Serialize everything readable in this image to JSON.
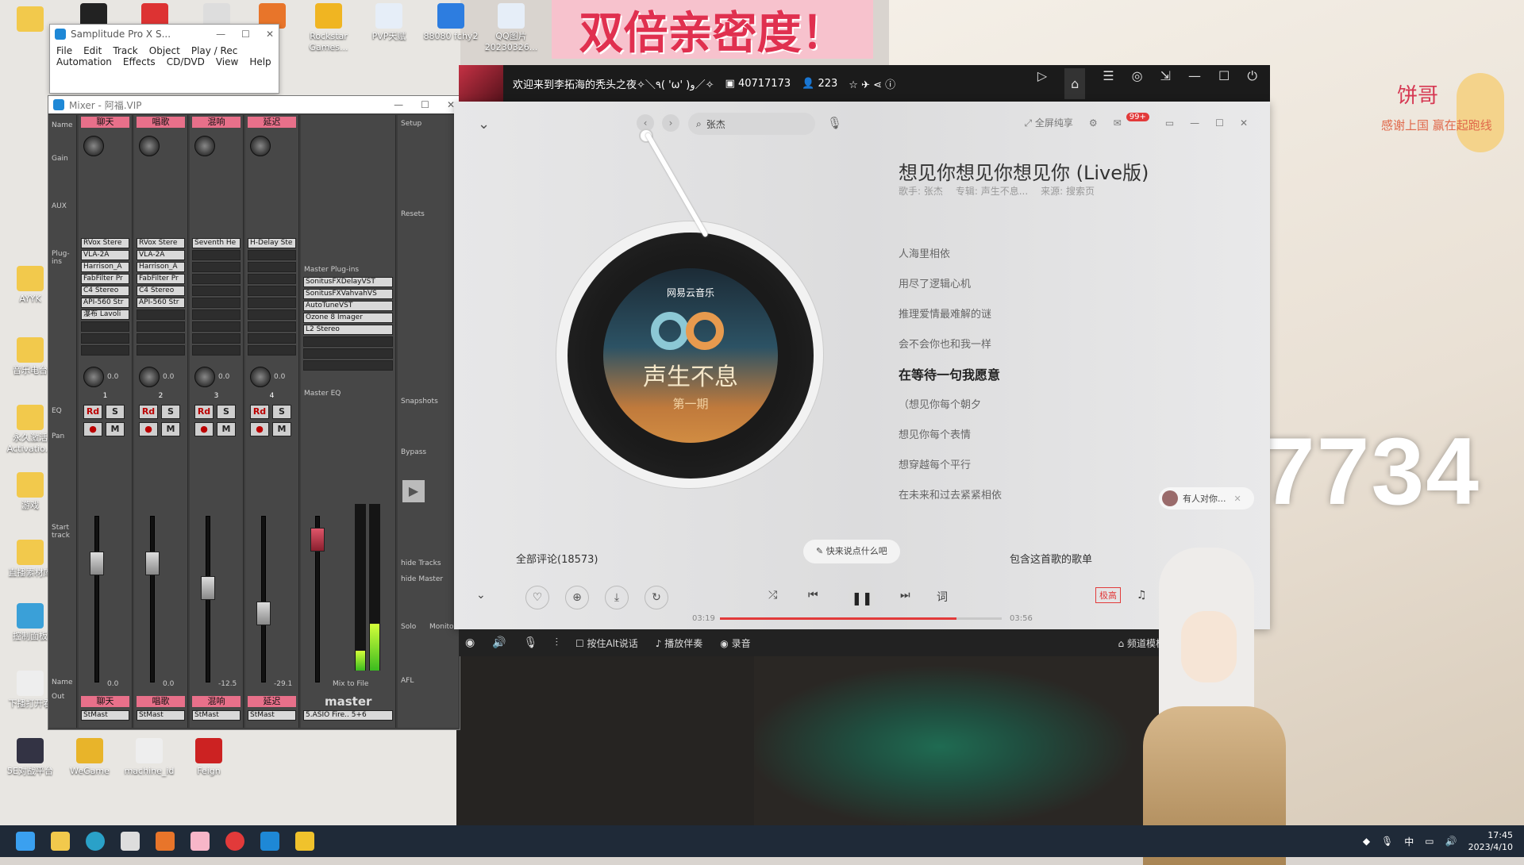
{
  "banner": {
    "text": "双倍亲密度！"
  },
  "big_number": "7734",
  "sticker": {
    "name": "饼哥",
    "thanks": "感谢上国 赢在起跑线"
  },
  "desktop_icons": [
    {
      "label": "",
      "color": "#f2c94c"
    },
    {
      "label": "",
      "color": "#222"
    },
    {
      "label": "",
      "color": "#d33"
    },
    {
      "label": "",
      "color": "#ddd"
    },
    {
      "label": "",
      "color": "#e8752a"
    },
    {
      "label": "Rockstar Games...",
      "color": "#f0b522"
    },
    {
      "label": "PVP天赋",
      "color": "#e6eef8"
    },
    {
      "label": "88080 fchy2",
      "color": "#2d7de0"
    },
    {
      "label": "QQ图片 20230326...",
      "color": "#e6eef8"
    },
    {
      "label": "AYYK",
      "color": "#f2c94c"
    },
    {
      "label": "音乐电台",
      "color": "#f2c94c"
    },
    {
      "label": "永久激活 Activatio...",
      "color": "#f2c94c"
    },
    {
      "label": "游戏",
      "color": "#f2c94c"
    },
    {
      "label": "直播素材库",
      "color": "#f2c94c"
    },
    {
      "label": "控制面板",
      "color": "#3aa0d8"
    },
    {
      "label": "下播打开看",
      "color": "#eee"
    },
    {
      "label": "5E对战平台",
      "color": "#334"
    },
    {
      "label": "WeGame",
      "color": "#e8b42a"
    },
    {
      "label": "machine_id",
      "color": "#eee"
    },
    {
      "label": "Feign",
      "color": "#c22"
    }
  ],
  "samplitude": {
    "title": "Samplitude Pro X S...",
    "menu": [
      "File",
      "Edit",
      "Track",
      "Object",
      "Play / Rec",
      "Automation",
      "Effects",
      "CD/DVD",
      "View",
      "Help"
    ]
  },
  "mixer": {
    "title": "Mixer - 阿福.VIP",
    "tracks": [
      {
        "num": "1",
        "name": "聊天",
        "plugins": [
          "RVox Stere",
          "VLA-2A",
          "Harrison_A",
          "FabFilter Pr",
          "C4 Stereo",
          "API-560 Str",
          "瀑布 Lavoli"
        ],
        "pan": "0.0",
        "fader_pos": 0.25,
        "value": "0.0"
      },
      {
        "num": "2",
        "name": "唱歌",
        "plugins": [
          "RVox Stere",
          "VLA-2A",
          "Harrison_A",
          "FabFilter Pr",
          "C4 Stereo",
          "API-560 Str"
        ],
        "pan": "0.0",
        "fader_pos": 0.25,
        "value": "0.0"
      },
      {
        "num": "3",
        "name": "混响",
        "plugins": [
          "Seventh He"
        ],
        "pan": "0.0",
        "fader_pos": 0.42,
        "value": "-12.5"
      },
      {
        "num": "4",
        "name": "延迟",
        "plugins": [
          "H-Delay Ste"
        ],
        "pan": "0.0",
        "fader_pos": 0.6,
        "value": "-29.1"
      }
    ],
    "master_plugins": [
      "SonitusFXDelayVST",
      "SonitusFXVahvahVS",
      "AutoTuneVST",
      "Ozone 8 Imager",
      "L2 Stereo"
    ],
    "labels": {
      "name": "Name",
      "gain": "Gain",
      "aux": "AUX",
      "plugins": "Plug-ins",
      "master_plugins": "Master Plug-ins",
      "eq": "EQ",
      "master_eq": "Master EQ",
      "pan": "Pan",
      "out": "Out",
      "setup": "Setup",
      "resets": "Resets",
      "snapshots": "Snapshots",
      "master": "master",
      "afl": "AFL",
      "solo": "Solo",
      "monitor": "Monitor",
      "bypass": "Bypass",
      "start_track": "Start track",
      "hide_tracks": "hide Tracks",
      "hide_master": "hide Master",
      "mix_to_file": "Mix to File",
      "out_master": "StMast",
      "master_out": "5.ASIO Fire.. 5+6"
    },
    "master_levels": {
      "left": 0.12,
      "right": 0.28
    }
  },
  "stream": {
    "title": "欢迎来到李拓海的秃头之夜✧＼٩( 'ω' )و／✧",
    "room_id": "40717173",
    "viewers": "223"
  },
  "player": {
    "search": "张杰",
    "fullscreen": "全屏纯享",
    "badge": "99+",
    "song_title": "想见你想见你想见你 (Live版)",
    "artist": "歌手: 张杰",
    "album": "专辑: 声生不息...",
    "source": "来源: 搜索页",
    "disc_brand": "网易云音乐",
    "disc_title": "声生不息",
    "disc_sub": "第一期",
    "lyrics": [
      {
        "text": "人海里相依",
        "current": false
      },
      {
        "text": "用尽了逻辑心机",
        "current": false
      },
      {
        "text": "推理爱情最难解的谜",
        "current": false
      },
      {
        "text": "会不会你也和我一样",
        "current": false
      },
      {
        "text": "在等待一句我愿意",
        "current": true
      },
      {
        "text": "（想见你每个朝夕",
        "current": false
      },
      {
        "text": "想见你每个表情",
        "current": false
      },
      {
        "text": "想穿越每个平行",
        "current": false
      },
      {
        "text": "在未来和过去紧紧相依",
        "current": false
      }
    ],
    "comments": "全部评论(18573)",
    "comment_prompt": "快来说点什么吧",
    "playlists": "包含这首歌的歌单",
    "time_elapsed": "03:19",
    "time_total": "03:56",
    "progress": 0.84,
    "quality": "极高",
    "lyric_btn": "词",
    "notification": "有人对你..."
  },
  "voicebar": {
    "ptt": "按住Alt说话",
    "accompany": "播放伴奏",
    "record": "录音",
    "channel": "频道模板"
  },
  "clock": {
    "time": "17:45",
    "date": "2023/4/10"
  },
  "tray": {
    "lang": "中"
  }
}
